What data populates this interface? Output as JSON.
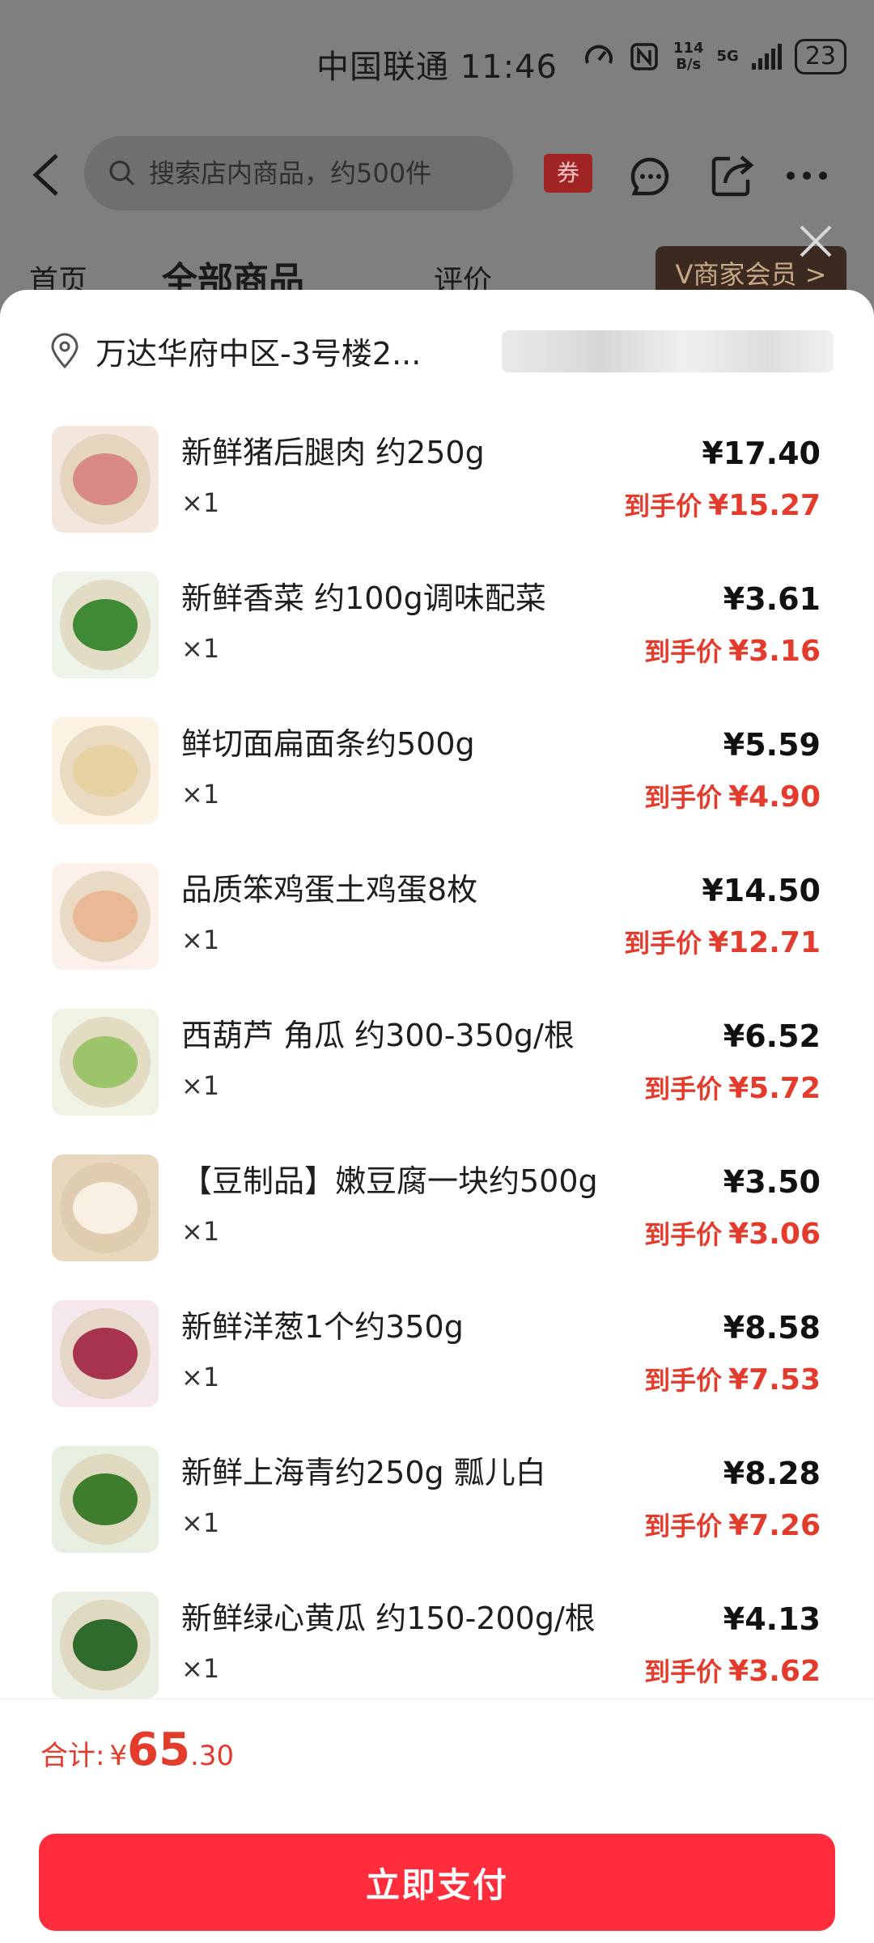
{
  "status_bar": {
    "carrier_time": "中国联通 11:46",
    "net_speed_value": "114",
    "net_speed_unit": "B/s",
    "network": "5G",
    "battery": "23"
  },
  "nav": {
    "search_placeholder": "搜索店内商品，约500件",
    "coupon_label": "券"
  },
  "tabs": {
    "home": "首页",
    "all_products": "全部商品",
    "reviews": "评价",
    "member": "V商家会员 >"
  },
  "address": {
    "text": "万达华府中区-3号楼2..."
  },
  "items": [
    {
      "name": "新鲜猪后腿肉 约250g",
      "qty": "×1",
      "price": "¥17.40",
      "final_label": "到手价",
      "final_price": "¥15.27"
    },
    {
      "name": "新鲜香菜 约100g调味配菜",
      "qty": "×1",
      "price": "¥3.61",
      "final_label": "到手价",
      "final_price": "¥3.16"
    },
    {
      "name": "鲜切面扁面条约500g",
      "qty": "×1",
      "price": "¥5.59",
      "final_label": "到手价",
      "final_price": "¥4.90"
    },
    {
      "name": "品质笨鸡蛋土鸡蛋8枚",
      "qty": "×1",
      "price": "¥14.50",
      "final_label": "到手价",
      "final_price": "¥12.71"
    },
    {
      "name": "西葫芦 角瓜 约300-350g/根",
      "qty": "×1",
      "price": "¥6.52",
      "final_label": "到手价",
      "final_price": "¥5.72"
    },
    {
      "name": "【豆制品】嫩豆腐一块约500g",
      "qty": "×1",
      "price": "¥3.50",
      "final_label": "到手价",
      "final_price": "¥3.06"
    },
    {
      "name": "新鲜洋葱1个约350g",
      "qty": "×1",
      "price": "¥8.58",
      "final_label": "到手价",
      "final_price": "¥7.53"
    },
    {
      "name": "新鲜上海青约250g 瓢儿白",
      "qty": "×1",
      "price": "¥8.28",
      "final_label": "到手价",
      "final_price": "¥7.26"
    },
    {
      "name": "新鲜绿心黄瓜 约150-200g/根",
      "qty": "×1",
      "price": "¥4.13",
      "final_label": "到手价",
      "final_price": "¥3.62"
    }
  ],
  "footer": {
    "total_label": "合计:",
    "currency": "¥",
    "total_int": "65",
    "total_dec": ".30",
    "pay_button": "立即支付"
  },
  "colors": {
    "accent_red": "#e33b2c",
    "pay_button": "#ff2c3c"
  }
}
